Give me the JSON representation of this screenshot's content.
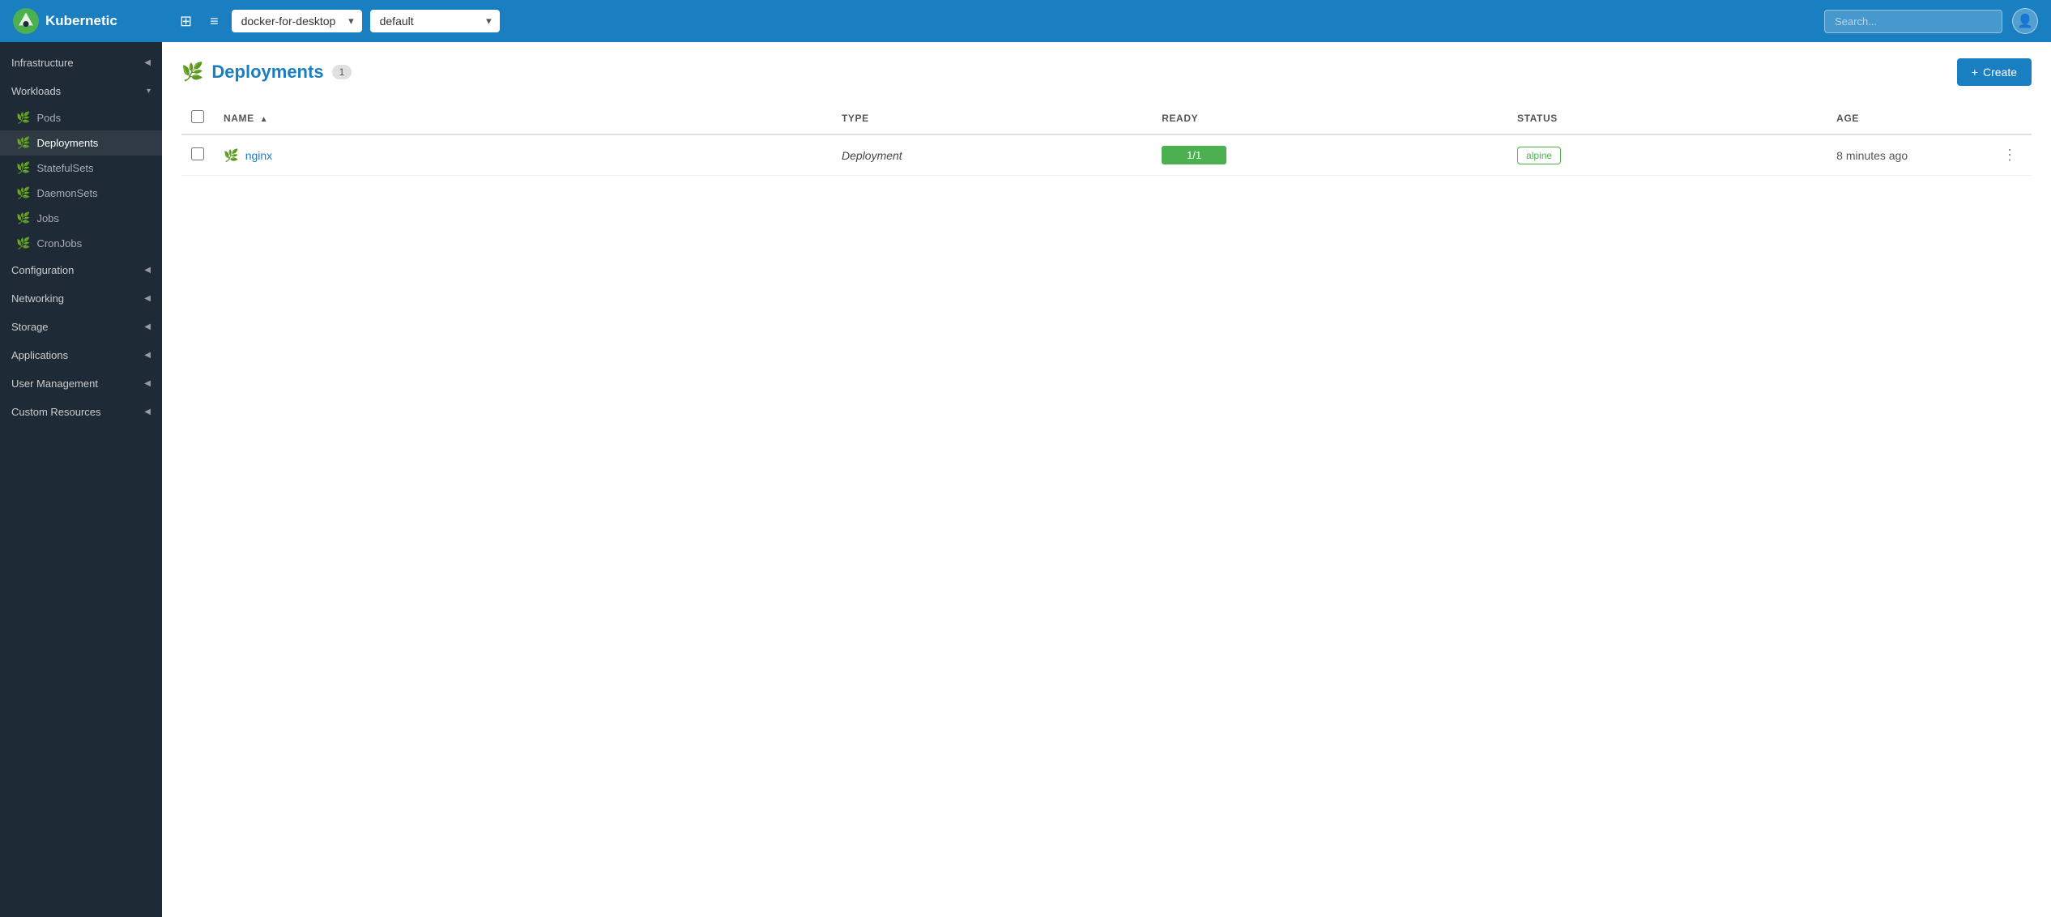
{
  "brand": {
    "logo_alt": "Kubernetic logo",
    "name": "Kubernetic"
  },
  "topbar": {
    "grid_icon": "⊞",
    "menu_icon": "≡",
    "cluster_dropdown": {
      "selected": "docker-for-desktop",
      "options": [
        "docker-for-desktop"
      ]
    },
    "namespace_dropdown": {
      "selected": "default",
      "options": [
        "default"
      ]
    },
    "search_placeholder": "Search...",
    "user_icon": "👤"
  },
  "sidebar": {
    "sections": [
      {
        "id": "infrastructure",
        "label": "Infrastructure",
        "collapsed": false,
        "items": []
      },
      {
        "id": "workloads",
        "label": "Workloads",
        "collapsed": false,
        "items": [
          {
            "id": "pods",
            "label": "Pods",
            "active": false
          },
          {
            "id": "deployments",
            "label": "Deployments",
            "active": true
          },
          {
            "id": "statefulsets",
            "label": "StatefulSets",
            "active": false
          },
          {
            "id": "daemonsets",
            "label": "DaemonSets",
            "active": false
          },
          {
            "id": "jobs",
            "label": "Jobs",
            "active": false
          },
          {
            "id": "cronjobs",
            "label": "CronJobs",
            "active": false
          }
        ]
      },
      {
        "id": "configuration",
        "label": "Configuration",
        "collapsed": false,
        "items": []
      },
      {
        "id": "networking",
        "label": "Networking",
        "collapsed": false,
        "items": []
      },
      {
        "id": "storage",
        "label": "Storage",
        "collapsed": false,
        "items": []
      },
      {
        "id": "applications",
        "label": "Applications",
        "collapsed": false,
        "items": []
      },
      {
        "id": "user-management",
        "label": "User Management",
        "collapsed": false,
        "items": []
      },
      {
        "id": "custom-resources",
        "label": "Custom Resources",
        "collapsed": false,
        "items": []
      }
    ]
  },
  "page": {
    "icon": "🌿",
    "title": "Deployments",
    "count": 1,
    "create_label": "Create",
    "create_icon": "+"
  },
  "table": {
    "columns": [
      {
        "id": "name",
        "label": "NAME",
        "sortable": true,
        "sort_asc": true
      },
      {
        "id": "type",
        "label": "TYPE",
        "sortable": false
      },
      {
        "id": "ready",
        "label": "READY",
        "sortable": false
      },
      {
        "id": "status",
        "label": "STATUS",
        "sortable": false
      },
      {
        "id": "age",
        "label": "AGE",
        "sortable": false
      }
    ],
    "rows": [
      {
        "name": "nginx",
        "type": "Deployment",
        "ready": "1/1",
        "status": "alpine",
        "age": "8 minutes ago"
      }
    ]
  }
}
